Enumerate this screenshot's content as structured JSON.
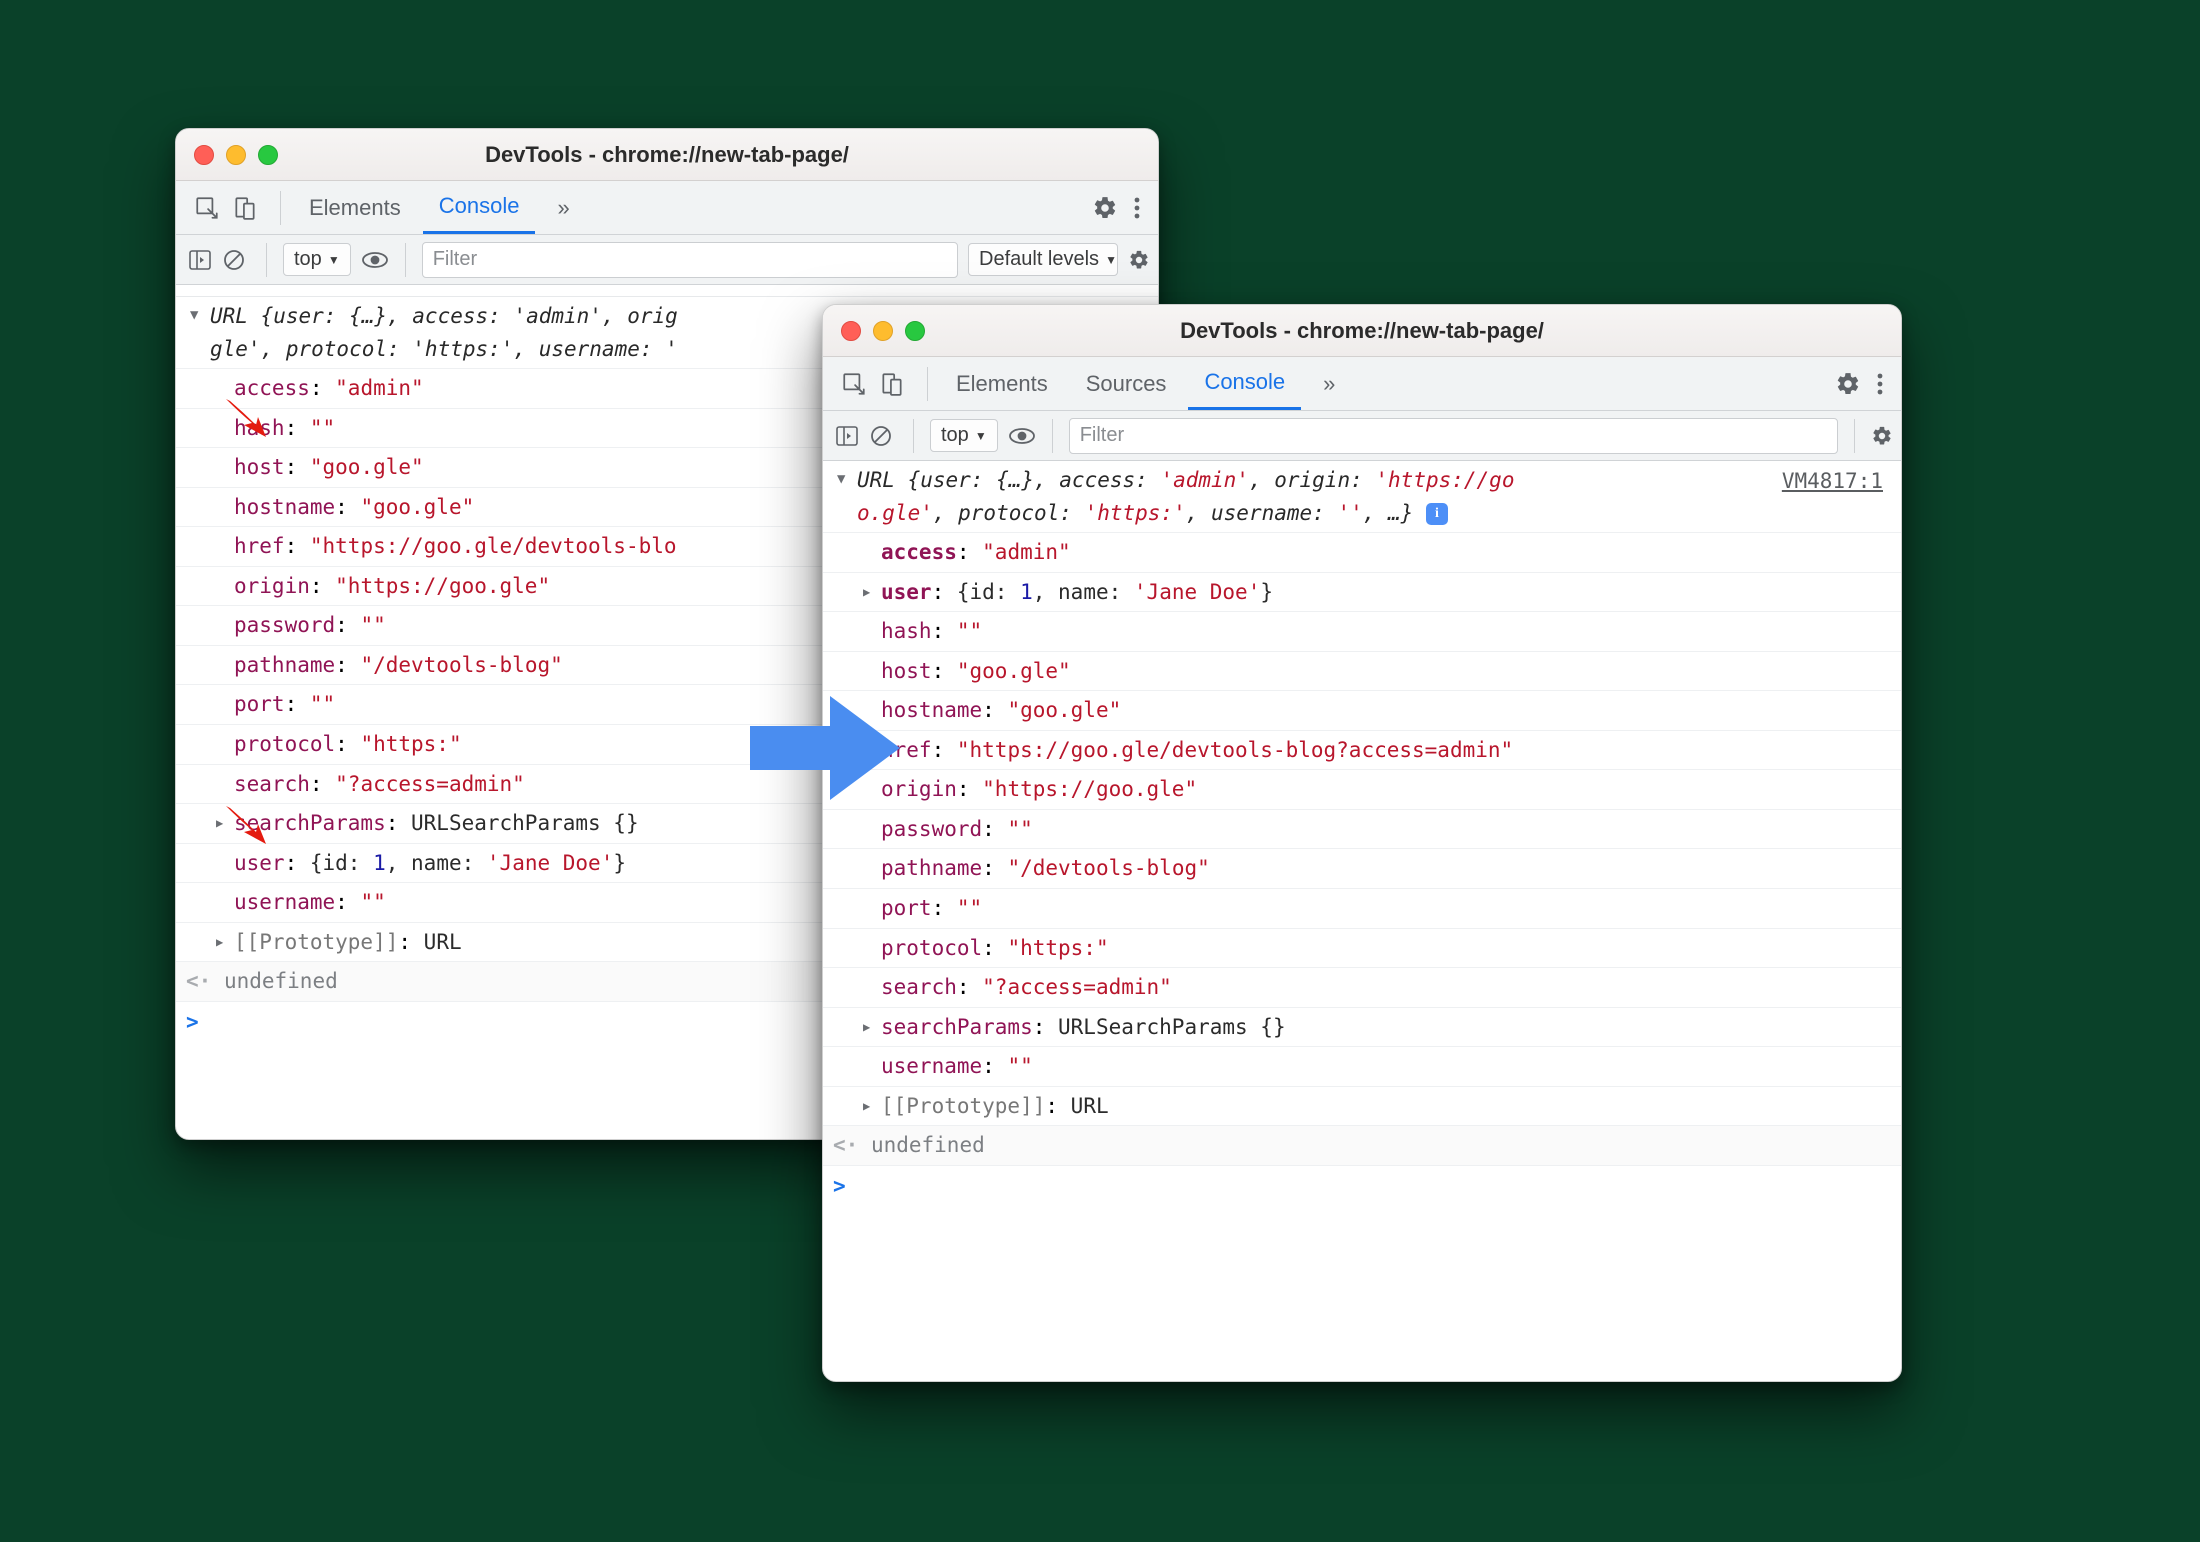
{
  "win1": {
    "title": "DevTools - chrome://new-tab-page/",
    "tabs": {
      "elements": "Elements",
      "console": "Console"
    },
    "filter": {
      "context": "top",
      "placeholder": "Filter",
      "levels": "Default levels"
    },
    "summary_line1": "URL {user: {…}, access: 'admin', orig",
    "summary_line2": "gle', protocol: 'https:', username: '",
    "props": {
      "access": {
        "k": "access",
        "v": "\"admin\""
      },
      "hash": {
        "k": "hash",
        "v": "\"\""
      },
      "host": {
        "k": "host",
        "v": "\"goo.gle\""
      },
      "hostname": {
        "k": "hostname",
        "v": "\"goo.gle\""
      },
      "href": {
        "k": "href",
        "v": "\"https://goo.gle/devtools-blo"
      },
      "origin": {
        "k": "origin",
        "v": "\"https://goo.gle\""
      },
      "password": {
        "k": "password",
        "v": "\"\""
      },
      "pathname": {
        "k": "pathname",
        "v": "\"/devtools-blog\""
      },
      "port": {
        "k": "port",
        "v": "\"\""
      },
      "protocol": {
        "k": "protocol",
        "v": "\"https:\""
      },
      "search": {
        "k": "search",
        "v": "\"?access=admin\""
      },
      "searchParams": {
        "k": "searchParams",
        "v": "URLSearchParams {}"
      },
      "user_k": "user",
      "user_pre": "{id: ",
      "user_id": "1",
      "user_mid": ", name: ",
      "user_name": "'Jane Doe'",
      "user_post": "}",
      "username": {
        "k": "username",
        "v": "\"\""
      },
      "proto": {
        "k": "[[Prototype]]",
        "v": "URL"
      }
    },
    "undefined": "undefined"
  },
  "win2": {
    "title": "DevTools - chrome://new-tab-page/",
    "tabs": {
      "elements": "Elements",
      "sources": "Sources",
      "console": "Console"
    },
    "filter": {
      "context": "top",
      "placeholder": "Filter"
    },
    "source_link": "VM4817:1",
    "summary_line1a": "URL {user: {…}, access: ",
    "summary_line1b": "'admin'",
    "summary_line1c": ", origin: ",
    "summary_line1d": "'https://go",
    "summary_line2a": "o.gle'",
    "summary_line2b": ", protocol: ",
    "summary_line2c": "'https:'",
    "summary_line2d": ", username: ",
    "summary_line2e": "''",
    "summary_line2f": ", …}",
    "props": {
      "access": {
        "k": "access",
        "v": "\"admin\""
      },
      "user_k": "user",
      "user_pre": "{id: ",
      "user_id": "1",
      "user_mid": ", name: ",
      "user_name": "'Jane Doe'",
      "user_post": "}",
      "hash": {
        "k": "hash",
        "v": "\"\""
      },
      "host": {
        "k": "host",
        "v": "\"goo.gle\""
      },
      "hostname": {
        "k": "hostname",
        "v": "\"goo.gle\""
      },
      "href": {
        "k": "href",
        "v": "\"https://goo.gle/devtools-blog?access=admin\""
      },
      "origin": {
        "k": "origin",
        "v": "\"https://goo.gle\""
      },
      "password": {
        "k": "password",
        "v": "\"\""
      },
      "pathname": {
        "k": "pathname",
        "v": "\"/devtools-blog\""
      },
      "port": {
        "k": "port",
        "v": "\"\""
      },
      "protocol": {
        "k": "protocol",
        "v": "\"https:\""
      },
      "search": {
        "k": "search",
        "v": "\"?access=admin\""
      },
      "searchParams": {
        "k": "searchParams",
        "v": "URLSearchParams {}"
      },
      "username": {
        "k": "username",
        "v": "\"\""
      },
      "proto": {
        "k": "[[Prototype]]",
        "v": "URL"
      }
    },
    "undefined": "undefined"
  }
}
